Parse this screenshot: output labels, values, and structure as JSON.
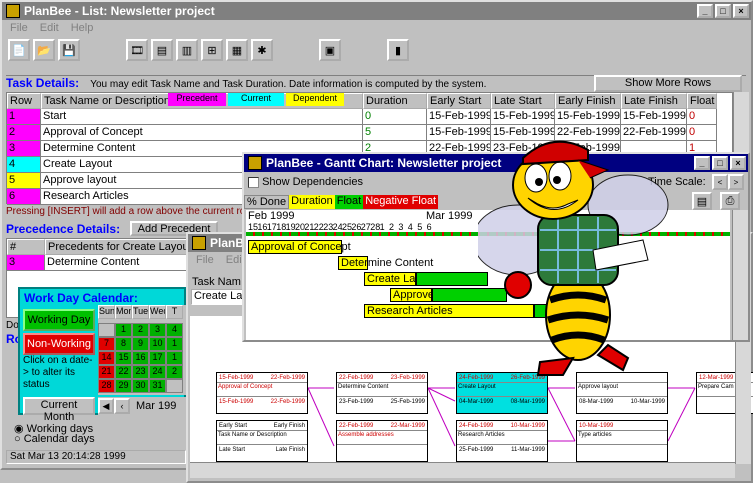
{
  "main": {
    "title": "PlanBee - List: Newsletter project",
    "menu": [
      "File",
      "Edit",
      "Help"
    ],
    "task_details": "Task Details:",
    "task_hint": "You may edit Task Name and Task Duration.  Date information is computed by the system.",
    "show_more": "Show More Rows",
    "legend": [
      "Precedent",
      "Current",
      "Dependent"
    ],
    "columns": [
      "Row",
      "Task Name or Description",
      "Duration",
      "Early Start",
      "Late Start",
      "Early Finish",
      "Late Finish",
      "Float"
    ],
    "rows": [
      {
        "row": "1",
        "name": "Start",
        "dur": "0",
        "es": "15-Feb-1999",
        "ls": "15-Feb-1999",
        "ef": "15-Feb-1999",
        "lf": "15-Feb-1999",
        "fl": "0"
      },
      {
        "row": "2",
        "name": "Approval of Concept",
        "dur": "5",
        "es": "15-Feb-1999",
        "ls": "15-Feb-1999",
        "ef": "22-Feb-1999",
        "lf": "22-Feb-1999",
        "fl": "0"
      },
      {
        "row": "3",
        "name": "Determine Content",
        "dur": "2",
        "es": "22-Feb-1999",
        "ls": "23-Feb-1999",
        "ef": "25-Feb-1999",
        "lf": "",
        "fl": "1"
      },
      {
        "row": "4",
        "name": "Create Layout",
        "dur": "",
        "es": "",
        "ls": "",
        "ef": "",
        "lf": "",
        "fl": ""
      },
      {
        "row": "5",
        "name": "Approve layout",
        "dur": "",
        "es": "",
        "ls": "",
        "ef": "",
        "lf": "",
        "fl": ""
      },
      {
        "row": "6",
        "name": "Research Articles",
        "dur": "",
        "es": "",
        "ls": "",
        "ef": "",
        "lf": "",
        "fl": ""
      }
    ],
    "insert_hint": "Pressing [INSERT] will add a row above the current row.",
    "prec_details": "Precedence Details:",
    "add_precedent": "Add Precedent",
    "prec_cols": [
      "#",
      "Precedents for Create Layout"
    ],
    "prec_rows": [
      {
        "n": "3",
        "name": "Determine Content"
      }
    ],
    "do_label": "Do",
    "ro_label": "Ro",
    "radio": [
      "Working days",
      "Calendar days"
    ],
    "status": "Sat Mar 13 20:14:28 1999"
  },
  "calendar": {
    "title": "Work Day Calendar:",
    "working": "Working Day",
    "nonworking": "Non-Working",
    "hint": "Click on a date-> to alter its status",
    "current_month": "Current Month",
    "month": "Mar 199",
    "days": [
      "Sun",
      "Mon",
      "Tue",
      "Wed",
      "T"
    ],
    "weeks": [
      [
        "",
        "1",
        "2",
        "3",
        "4"
      ],
      [
        "7",
        "8",
        "9",
        "10",
        "1"
      ],
      [
        "14",
        "15",
        "16",
        "17",
        "1"
      ],
      [
        "21",
        "22",
        "23",
        "24",
        "2"
      ],
      [
        "28",
        "29",
        "30",
        "31",
        ""
      ]
    ]
  },
  "network": {
    "title": "PlanBee",
    "menu": [
      "File",
      "Edi"
    ],
    "task_name_label": "Task Nam",
    "task_name_value": "Create La",
    "boxes": [
      {
        "d1": "15-Feb-1999",
        "d2": "22-Feb-1999",
        "name": "Approval of Concept",
        "d3": "15-Feb-1999",
        "d4": "22-Feb-1999"
      },
      {
        "d1": "22-Feb-1999",
        "d2": "23-Feb-1999",
        "name": "Determine Content",
        "d3": "23-Feb-1999",
        "d4": "25-Feb-1999"
      },
      {
        "d1": "24-Feb-1999",
        "d2": "26-Feb-1999",
        "name": "Create Layout",
        "d3": "04-Mar-1999",
        "d4": "08-Mar-1999"
      },
      {
        "d1": "",
        "d2": "",
        "name": "Approve layout",
        "d3": "08-Mar-1999",
        "d4": "10-Mar-1999"
      },
      {
        "d1": "12-Mar-1999",
        "d2": "",
        "name": "Prepare Cam copy",
        "d3": "",
        "d4": ""
      },
      {
        "d1": "Early Start",
        "d2": "Early Finish",
        "name": "Task Name or Description",
        "d3": "Late Start",
        "d4": "Late Finish"
      },
      {
        "d1": "22-Feb-1999",
        "d2": "22-Mar-1999",
        "name": "Assemble addresses",
        "d3": "",
        "d4": ""
      },
      {
        "d1": "24-Feb-1999",
        "d2": "10-Mar-1999",
        "name": "Research Articles",
        "d3": "25-Feb-1999",
        "d4": "11-Mar-1999"
      },
      {
        "d1": "10-Mar-1999",
        "d2": "",
        "name": "Type articles",
        "d3": "",
        "d4": ""
      }
    ]
  },
  "gantt": {
    "title": "PlanBee - Gantt Chart: Newsletter project",
    "show_dep": "Show Dependencies",
    "time_scale": "Time Scale:",
    "legend": [
      "% Done",
      "Duration",
      "Float",
      "Negative Float"
    ],
    "months": [
      "Feb 1999",
      "Mar 1999"
    ],
    "days": [
      "15",
      "16",
      "17",
      "18",
      "19",
      "20",
      "21",
      "22",
      "23",
      "24",
      "25",
      "26",
      "27",
      "28",
      "1",
      "2",
      "3",
      "4",
      "5",
      "6"
    ],
    "bars": [
      "Approval of Concept",
      "Determine Content",
      "Create Layout",
      "Approve layout",
      "Research Articles"
    ]
  },
  "colors": {
    "precedent": "#ff00ff",
    "current": "#00ffff",
    "dependent": "#ffff00",
    "title": "#000080",
    "bar": "#ffff00",
    "float": "#00d000"
  }
}
